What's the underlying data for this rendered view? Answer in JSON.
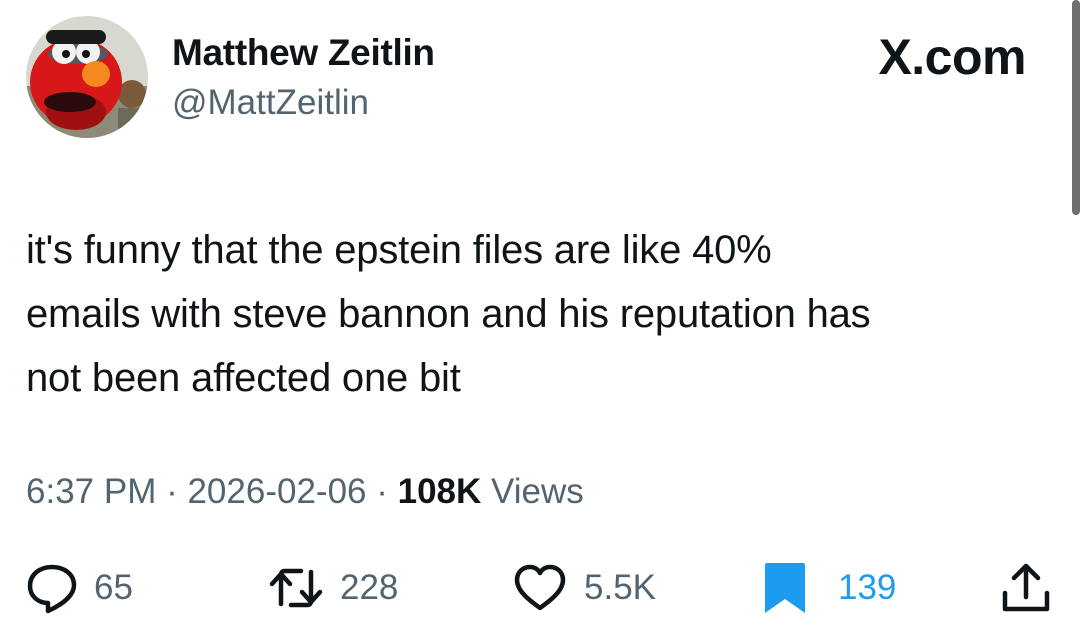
{
  "header": {
    "display_name": "Matthew Zeitlin",
    "handle": "@MattZeitlin",
    "brand": "X.com"
  },
  "tweet": {
    "text": "it's funny that the epstein files are like 40%\nemails with steve bannon and his reputation has\nnot been affected one bit",
    "time": "6:37 PM",
    "sep1": " · ",
    "date": "2026-02-06",
    "sep2": " · ",
    "views_count": "108K",
    "views_label": " Views"
  },
  "actions": {
    "replies": "65",
    "reposts": "228",
    "likes": "5.5K",
    "bookmarks": "139"
  },
  "icons": {
    "avatar": "elmo-avatar",
    "reply": "speech-bubble-icon",
    "repost": "repost-arrows-icon",
    "like": "heart-icon",
    "bookmark": "bookmark-icon",
    "share": "share-upload-icon"
  },
  "colors": {
    "text": "#0f1419",
    "muted": "#536471",
    "accent": "#1d9bf0"
  }
}
